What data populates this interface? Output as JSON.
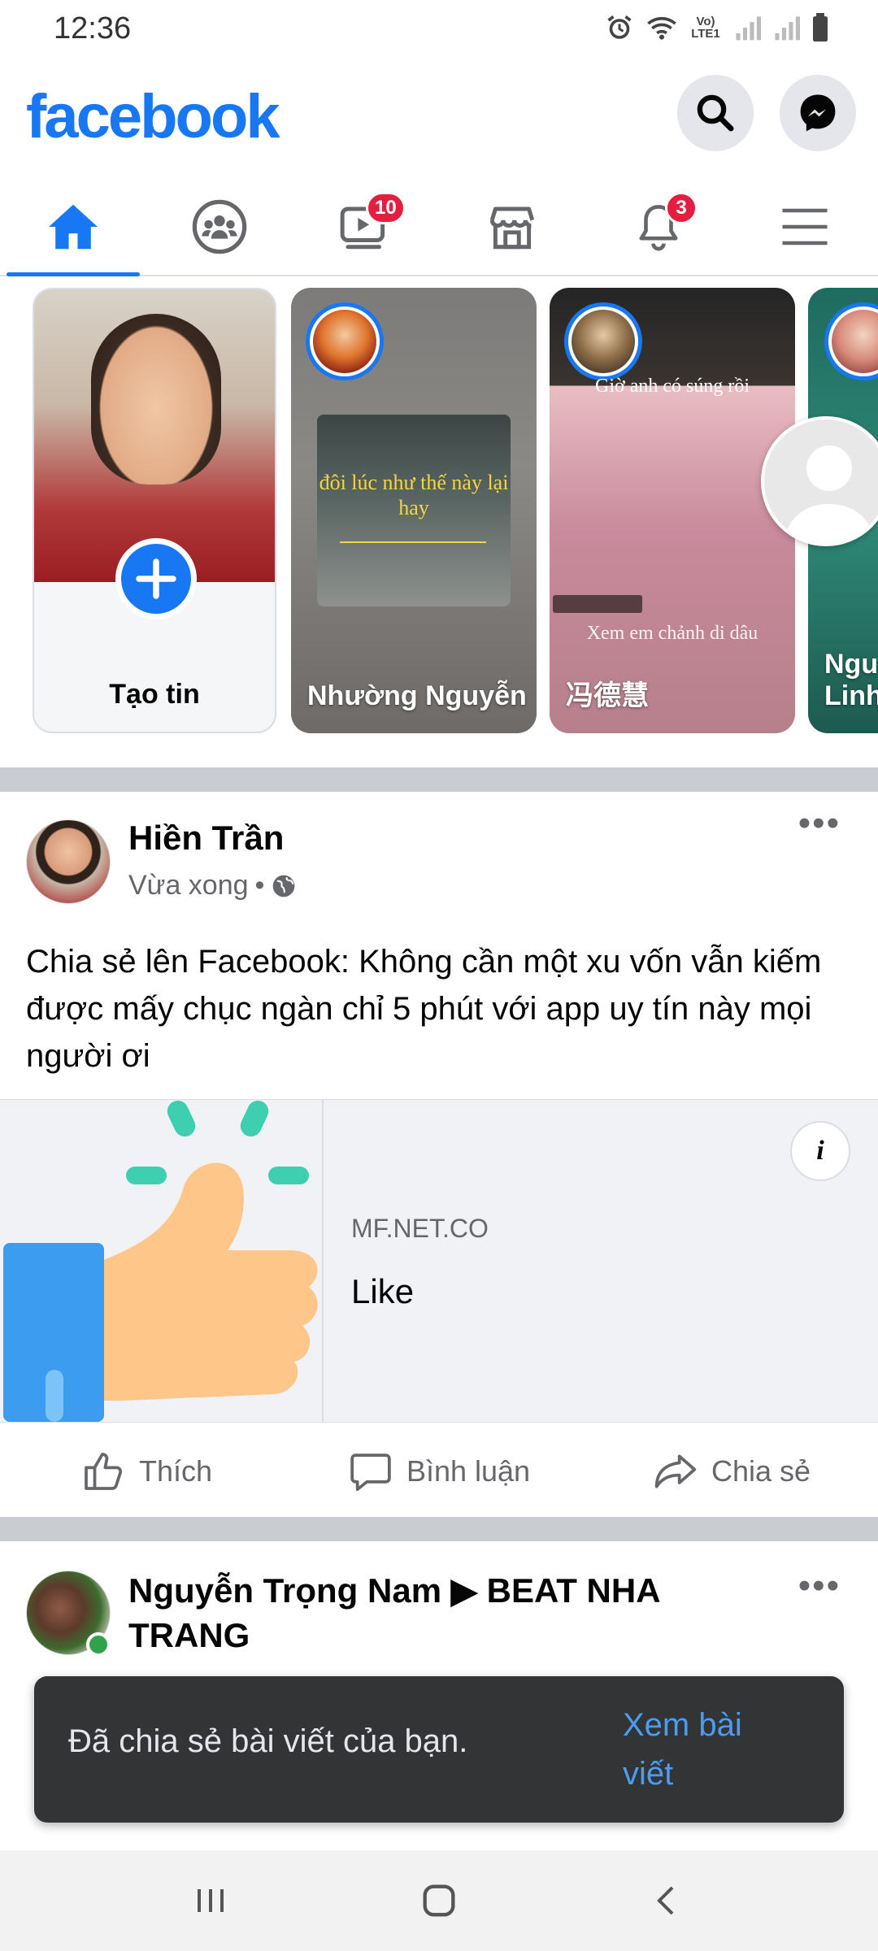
{
  "status_bar": {
    "time": "12:36",
    "network_label": "Vo) LTE1"
  },
  "header": {
    "logo": "facebook"
  },
  "tabs": [
    {
      "name": "home",
      "badge": ""
    },
    {
      "name": "groups",
      "badge": ""
    },
    {
      "name": "watch",
      "badge": "10"
    },
    {
      "name": "marketplace",
      "badge": ""
    },
    {
      "name": "notifications",
      "badge": "3"
    },
    {
      "name": "menu",
      "badge": ""
    }
  ],
  "stories": {
    "create_label": "Tạo tin",
    "items": [
      {
        "name": "Nhường Nguyễn",
        "caption": "đôi lúc như thế này lại hay"
      },
      {
        "name": "冯德慧",
        "caption_top": "Giờ anh có súng rồi",
        "caption_bottom": "Xem em chảnh di dâu"
      },
      {
        "name": "Ngu Linh"
      }
    ]
  },
  "post1": {
    "author": "Hiền Trần",
    "time": "Vừa xong",
    "text": "Chia sẻ lên Facebook: Không cần một xu vốn vẫn kiếm được mấy chục ngàn chỉ 5 phút với app uy tín này mọi người ơi",
    "link_domain": "MF.NET.CO",
    "link_title": "Like",
    "info_icon": "i"
  },
  "actions": {
    "like": "Thích",
    "comment": "Bình luận",
    "share": "Chia sẻ"
  },
  "post2": {
    "author": "Nguyễn Trọng Nam ▶ BEAT NHA TRANG"
  },
  "toast": {
    "message": "Đã chia sẻ bài viết của bạn.",
    "action": "Xem bài viết"
  },
  "colors": {
    "brand": "#1877f2",
    "badge": "#e41e3f",
    "toast_bg": "#323436",
    "toast_action": "#4a9cf5"
  }
}
